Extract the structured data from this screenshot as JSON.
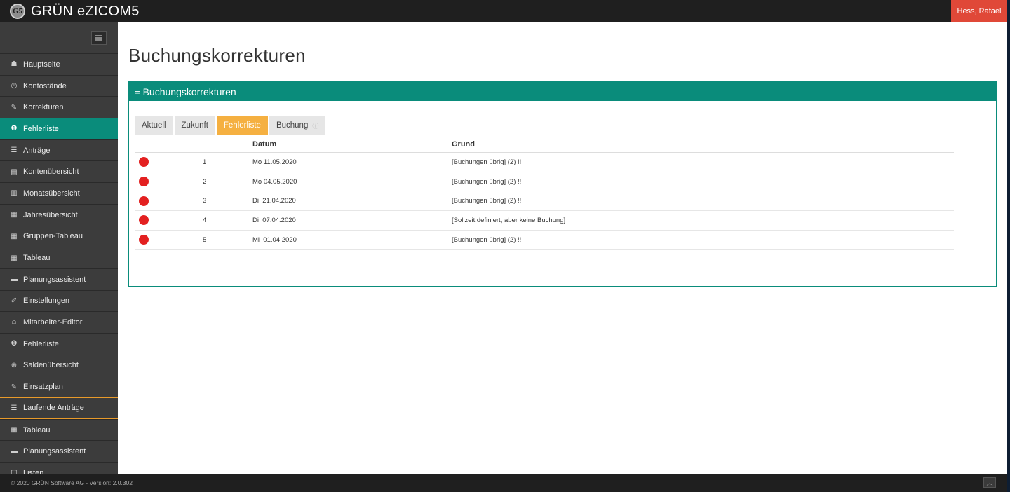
{
  "app": {
    "title": "GRÜN eZICOM5",
    "logo_mark": "G5",
    "user": "Hess, Rafael"
  },
  "sidebar": {
    "items": [
      {
        "label": "Hauptseite",
        "icon": "☗",
        "name": "home"
      },
      {
        "label": "Kontostände",
        "icon": "◷",
        "name": "kontostaende"
      },
      {
        "label": "Korrekturen",
        "icon": "✎",
        "name": "korrekturen"
      },
      {
        "label": "Fehlerliste",
        "icon": "❶",
        "name": "fehlerliste",
        "active": true
      },
      {
        "label": "Anträge",
        "icon": "☰",
        "name": "antraege"
      },
      {
        "label": "Kontenübersicht",
        "icon": "▤",
        "name": "kontenuebersicht"
      },
      {
        "label": "Monatsübersicht",
        "icon": "▥",
        "name": "monatsuebersicht"
      },
      {
        "label": "Jahresübersicht",
        "icon": "▦",
        "name": "jahresuebersicht"
      },
      {
        "label": "Gruppen-Tableau",
        "icon": "▦",
        "name": "gruppen-tableau"
      },
      {
        "label": "Tableau",
        "icon": "▦",
        "name": "tableau"
      },
      {
        "label": "Planungsassistent",
        "icon": "▬",
        "name": "planungsassistent"
      },
      {
        "label": "Einstellungen",
        "icon": "✐",
        "name": "einstellungen"
      },
      {
        "label": "Mitarbeiter-Editor",
        "icon": "☺",
        "name": "mitarbeiter-editor"
      },
      {
        "label": "Fehlerliste",
        "icon": "❶",
        "name": "fehlerliste-2"
      },
      {
        "label": "Saldenübersicht",
        "icon": "⊕",
        "name": "saldenuebersicht"
      },
      {
        "label": "Einsatzplan",
        "icon": "✎",
        "name": "einsatzplan"
      },
      {
        "label": "Laufende Anträge",
        "icon": "☰",
        "name": "laufende-antraege"
      },
      {
        "label": "Tableau",
        "icon": "▦",
        "name": "tableau-2"
      },
      {
        "label": "Planungsassistent",
        "icon": "▬",
        "name": "planungsassistent-2"
      },
      {
        "label": "Listen",
        "icon": "▢",
        "name": "listen"
      }
    ]
  },
  "main": {
    "title": "Buchungskorrekturen",
    "panel_title": "Buchungskorrekturen",
    "panel_icon": "≡",
    "tabs": [
      {
        "label": "Aktuell"
      },
      {
        "label": "Zukunft"
      },
      {
        "label": "Fehlerliste",
        "active": true
      },
      {
        "label": "Buchung",
        "icon": "ⓘ"
      }
    ],
    "table": {
      "headers": [
        "",
        "",
        "Datum",
        "Grund"
      ],
      "rows": [
        {
          "num": "1",
          "date": "Mo 11.05.2020",
          "reason": "[Buchungen übrig] (2) !!"
        },
        {
          "num": "2",
          "date": "Mo 04.05.2020",
          "reason": "[Buchungen übrig] (2) !!"
        },
        {
          "num": "3",
          "date": "Di  21.04.2020",
          "reason": "[Buchungen übrig] (2) !!"
        },
        {
          "num": "4",
          "date": "Di  07.04.2020",
          "reason": "[Sollzeit definiert, aber keine Buchung]"
        },
        {
          "num": "5",
          "date": "Mi  01.04.2020",
          "reason": "[Buchungen übrig] (2) !!"
        }
      ],
      "status_color": "#e32020"
    }
  },
  "footer": {
    "text": "© 2020 GRÜN Software AG - Version: 2.0.302",
    "scroll_icon": "︿"
  },
  "colors": {
    "accent": "#0a8c7b",
    "tab_active": "#f5b041",
    "user_badge": "#e04838"
  }
}
